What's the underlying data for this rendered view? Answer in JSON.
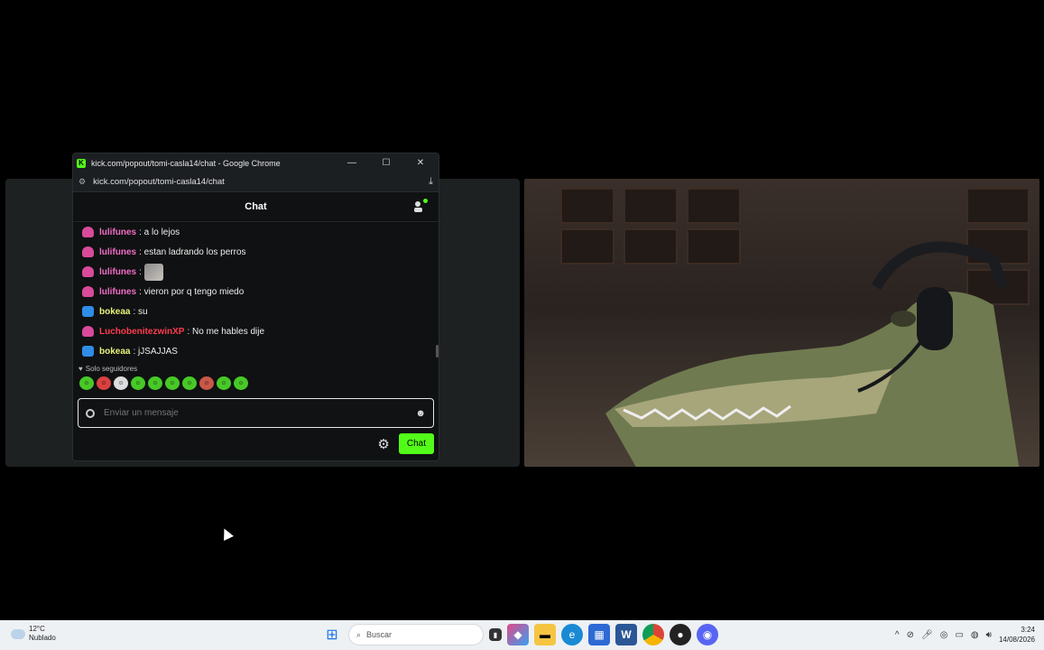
{
  "window": {
    "title": "kick.com/popout/tomi-casla14/chat - Google Chrome",
    "url": "kick.com/popout/tomi-casla14/chat",
    "minimize": "—",
    "maximize": "☐",
    "close": "✕"
  },
  "chat": {
    "header": "Chat",
    "messages": [
      {
        "user": "lulifunes",
        "text": ": a lo lejos",
        "user_color": "#f06cc4",
        "badge": "sub"
      },
      {
        "user": "lulifunes",
        "text": ": estan ladrando los perros",
        "user_color": "#f06cc4",
        "badge": "sub"
      },
      {
        "user": "lulifunes",
        "text": ":",
        "user_color": "#f06cc4",
        "badge": "sub",
        "emote": "cat-emote"
      },
      {
        "user": "lulifunes",
        "text": ": vieron por q tengo miedo",
        "user_color": "#f06cc4",
        "badge": "sub"
      },
      {
        "user": "bokeaa",
        "text": ": su",
        "user_color": "#e8f27c",
        "badge": "vip"
      },
      {
        "user": "LuchobenitezwinXP",
        "text": ": No me hables dije",
        "user_color": "#ff3b4e",
        "badge": "sub"
      },
      {
        "user": "bokeaa",
        "text": ": jJSAJJAS",
        "user_color": "#e8f27c",
        "badge": "vip"
      }
    ],
    "followers_only": "Solo seguidores",
    "input_placeholder": "Enviar un mensaje",
    "send_button": "Chat"
  },
  "taskbar": {
    "temperature": "12°C",
    "weather": "Nublado",
    "search_placeholder": "Buscar",
    "time": "3:24",
    "date": "14/08/2026"
  },
  "colors": {
    "kick_green": "#53fc18",
    "taskbar_bg": "#eef1f4"
  }
}
